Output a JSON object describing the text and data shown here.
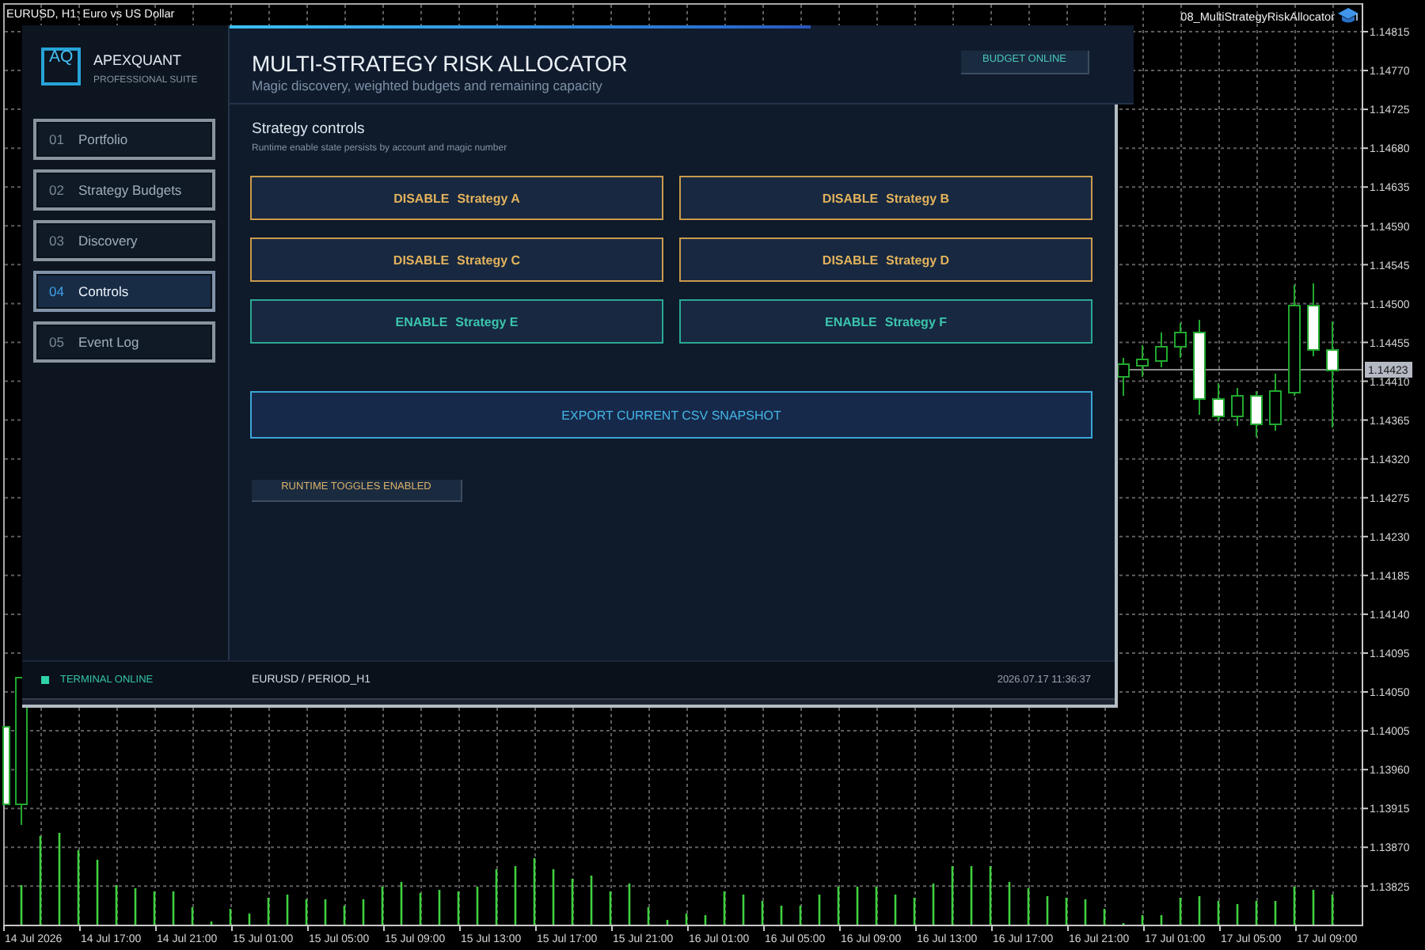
{
  "chart": {
    "title": "EURUSD, H1: Euro vs US Dollar",
    "expert": "08_MultiStrategyRiskAllocator",
    "price_labels": [
      "1.14815",
      "1.14770",
      "1.14725",
      "1.14680",
      "1.14635",
      "1.14590",
      "1.14545",
      "1.14500",
      "1.14455",
      "1.14410",
      "1.14365",
      "1.14320",
      "1.14275",
      "1.14230",
      "1.14185",
      "1.14140",
      "1.14095",
      "1.14050",
      "1.14005",
      "1.13960",
      "1.13915",
      "1.13870",
      "1.13825"
    ],
    "current_price": "1.14423",
    "time_labels": [
      "14 Jul 2026",
      "14 Jul 17:00",
      "14 Jul 21:00",
      "15 Jul 01:00",
      "15 Jul 05:00",
      "15 Jul 09:00",
      "15 Jul 13:00",
      "15 Jul 17:00",
      "15 Jul 21:00",
      "16 Jul 01:00",
      "16 Jul 05:00",
      "16 Jul 09:00",
      "16 Jul 13:00",
      "16 Jul 17:00",
      "16 Jul 21:00",
      "17 Jul 01:00",
      "17 Jul 05:00",
      "17 Jul 09:00"
    ]
  },
  "panel": {
    "brand": {
      "logo": "AQ",
      "name": "APEXQUANT",
      "tagline": "PROFESSIONAL SUITE"
    },
    "nav": [
      {
        "number": "01",
        "label": "Portfolio",
        "selected": false
      },
      {
        "number": "02",
        "label": "Strategy Budgets",
        "selected": false
      },
      {
        "number": "03",
        "label": "Discovery",
        "selected": false
      },
      {
        "number": "04",
        "label": "Controls",
        "selected": true
      },
      {
        "number": "05",
        "label": "Event Log",
        "selected": false
      }
    ],
    "header": {
      "title": "MULTI-STRATEGY RISK ALLOCATOR",
      "subtitle": "Magic discovery, weighted budgets and remaining capacity",
      "badge": "BUDGET ONLINE"
    },
    "section": {
      "title": "Strategy controls",
      "note": "Runtime enable state persists by account and magic number"
    },
    "strategies": [
      {
        "action": "DISABLE",
        "name": "Strategy A",
        "enabled": true
      },
      {
        "action": "DISABLE",
        "name": "Strategy B",
        "enabled": true
      },
      {
        "action": "DISABLE",
        "name": "Strategy C",
        "enabled": true
      },
      {
        "action": "DISABLE",
        "name": "Strategy D",
        "enabled": true
      },
      {
        "action": "ENABLE",
        "name": "Strategy E",
        "enabled": false
      },
      {
        "action": "ENABLE",
        "name": "Strategy F",
        "enabled": false
      }
    ],
    "export_button": "EXPORT CURRENT CSV SNAPSHOT",
    "status_chip": "RUNTIME TOGGLES ENABLED",
    "footer": {
      "status": "TERMINAL ONLINE",
      "symbol": "EURUSD / PERIOD_H1",
      "timestamp": "2026.07.17 11:36:37"
    }
  }
}
